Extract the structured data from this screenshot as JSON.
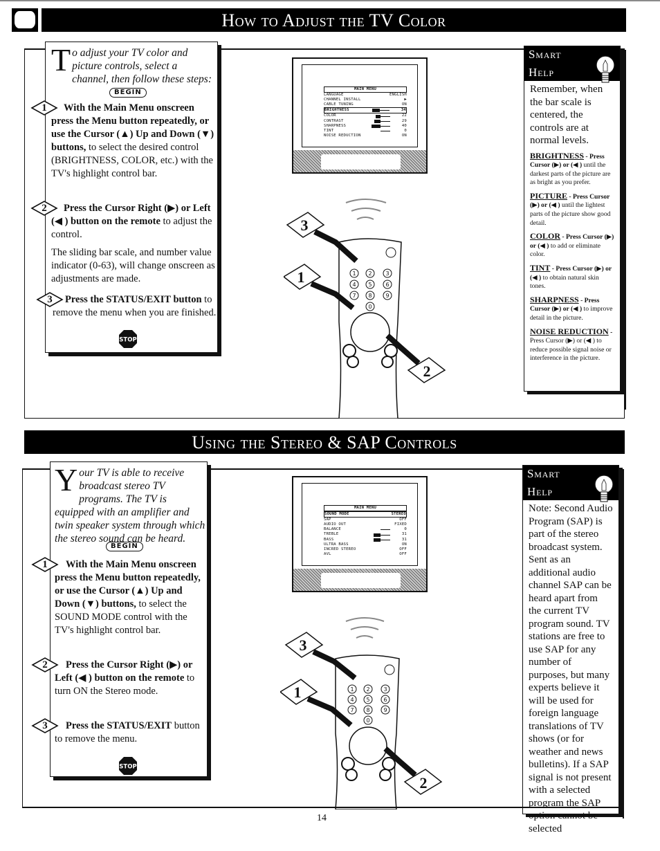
{
  "section1": {
    "title": "How to Adjust the TV Color",
    "intro_dropcap": "T",
    "intro_rest": "o adjust your TV color and picture controls, select a channel, then follow these steps:",
    "begin_label": "BEGIN",
    "steps": [
      {
        "num": "1",
        "bold": "With the Main Menu onscreen press the Menu button repeatedly, or use the Cursor (▲) Up and Down (▼) buttons,",
        "text": " to select the desired control (BRIGHTNESS, COLOR, etc.) with the TV's highlight control bar."
      },
      {
        "num": "2",
        "bold": "Press the Cursor Right (▶) or Left (◀ ) button on the remote",
        "text": " to adjust the control.",
        "extra": "The sliding bar scale, and number value indicator (0-63), will change onscreen as adjustments are made."
      },
      {
        "num": "3",
        "bold": "Press the STATUS/EXIT button",
        "text": " to remove the menu when you are finished."
      }
    ],
    "stop_label": "STOP",
    "menu": {
      "header": "MAIN MENU",
      "rows": [
        {
          "label": "LANGUAGE",
          "value": "ENGLISH",
          "bar": null,
          "highlight": false
        },
        {
          "label": "CHANNEL INSTALL",
          "value": "▶",
          "bar": null,
          "highlight": false
        },
        {
          "label": "CABLE TUNING",
          "value": "ON",
          "bar": null,
          "highlight": false
        },
        {
          "label": "BRIGHTNESS",
          "value": "34",
          "bar": 34,
          "highlight": true
        },
        {
          "label": "COLOR",
          "value": "22",
          "bar": 22,
          "highlight": false
        },
        {
          "label": "CONTRAST",
          "value": "29",
          "bar": 29,
          "highlight": false
        },
        {
          "label": "SHARPNESS",
          "value": "40",
          "bar": 40,
          "highlight": false
        },
        {
          "label": "TINT",
          "value": "0",
          "bar": 0,
          "highlight": false
        },
        {
          "label": "NOISE REDUCTION",
          "value": "ON",
          "bar": null,
          "highlight": false
        }
      ]
    },
    "remote_callouts": [
      "3",
      "1",
      "2"
    ],
    "smart_help": {
      "title_line1": "Smart",
      "title_line2": "Help",
      "lead": "Remember, when the bar scale is centered, the controls are at normal levels.",
      "tips": [
        {
          "term": "BRIGHTNESS",
          "bold": " - Press Cursor (▶) or (◀ )",
          "text": " until the darkest parts of the picture are as bright as you prefer."
        },
        {
          "term": "PICTURE",
          "bold": " - Press Cursor (▶) or (◀ )",
          "text": " until the lightest parts of the picture show good detail."
        },
        {
          "term": "COLOR",
          "bold": " - Press Cursor (▶) or (◀ )",
          "text": " to add or eliminate color."
        },
        {
          "term": "TINT",
          "bold": " - Press Cursor (▶) or (◀ )",
          "text": " to obtain natural skin tones."
        },
        {
          "term": "SHARPNESS",
          "bold": " - Press Cursor (▶) or (◀ )",
          "text": " to improve detail in the picture."
        },
        {
          "term": "NOISE REDUCTION",
          "bold": " -",
          "text": " Press Cursor (▶) or (◀ ) to reduce possible signal noise or interference in the picture."
        }
      ]
    }
  },
  "section2": {
    "title": "Using the Stereo & SAP Controls",
    "intro_dropcap": "Y",
    "intro_rest": "our TV is able to receive broadcast stereo TV programs. The TV is equipped with an amplifier and twin speaker system through which the stereo sound can be heard.",
    "begin_label": "BEGIN",
    "steps": [
      {
        "num": "1",
        "bold": "With the Main Menu onscreen press the Menu button repeatedly, or use the Cursor (▲) Up and Down (▼) buttons,",
        "text": " to select the SOUND MODE control with the TV's highlight control bar."
      },
      {
        "num": "2",
        "bold": "Press the Cursor Right (▶) or Left (◀ ) button on the remote",
        "text": " to turn ON the Stereo mode."
      },
      {
        "num": "3",
        "bold": "Press the STATUS/EXIT",
        "text": " button to remove the menu."
      }
    ],
    "stop_label": "STOP",
    "menu": {
      "header": "MAIN MENU",
      "rows": [
        {
          "label": "SOUND MODE",
          "value": "STEREO",
          "bar": null,
          "highlight": true
        },
        {
          "label": "SAP",
          "value": "OFF",
          "bar": null,
          "highlight": false
        },
        {
          "label": "AUDIO OUT",
          "value": "FIXED",
          "bar": null,
          "highlight": false
        },
        {
          "label": "BALANCE",
          "value": "0",
          "bar": 0,
          "highlight": false
        },
        {
          "label": "TREBLE",
          "value": "31",
          "bar": 31,
          "highlight": false
        },
        {
          "label": "BASS",
          "value": "31",
          "bar": 31,
          "highlight": false
        },
        {
          "label": "ULTRA BASS",
          "value": "ON",
          "bar": null,
          "highlight": false
        },
        {
          "label": "INCRED STEREO",
          "value": "OFF",
          "bar": null,
          "highlight": false
        },
        {
          "label": "AVL",
          "value": "OFF",
          "bar": null,
          "highlight": false
        }
      ]
    },
    "remote_callouts": [
      "3",
      "1",
      "2"
    ],
    "smart_help": {
      "title_line1": "Smart",
      "title_line2": "Help",
      "lead": "Note: Second Audio Program (SAP) is part of the stereo broadcast system. Sent as an additional audio channel SAP can be heard apart from the current TV program sound. TV stations are free to use SAP for any number of purposes, but many experts believe it will be used for foreign language translations of TV shows (or for weather and news bulletins). If a SAP signal is not present with a selected program the SAP option cannot be selected"
    }
  },
  "page_number": "14"
}
